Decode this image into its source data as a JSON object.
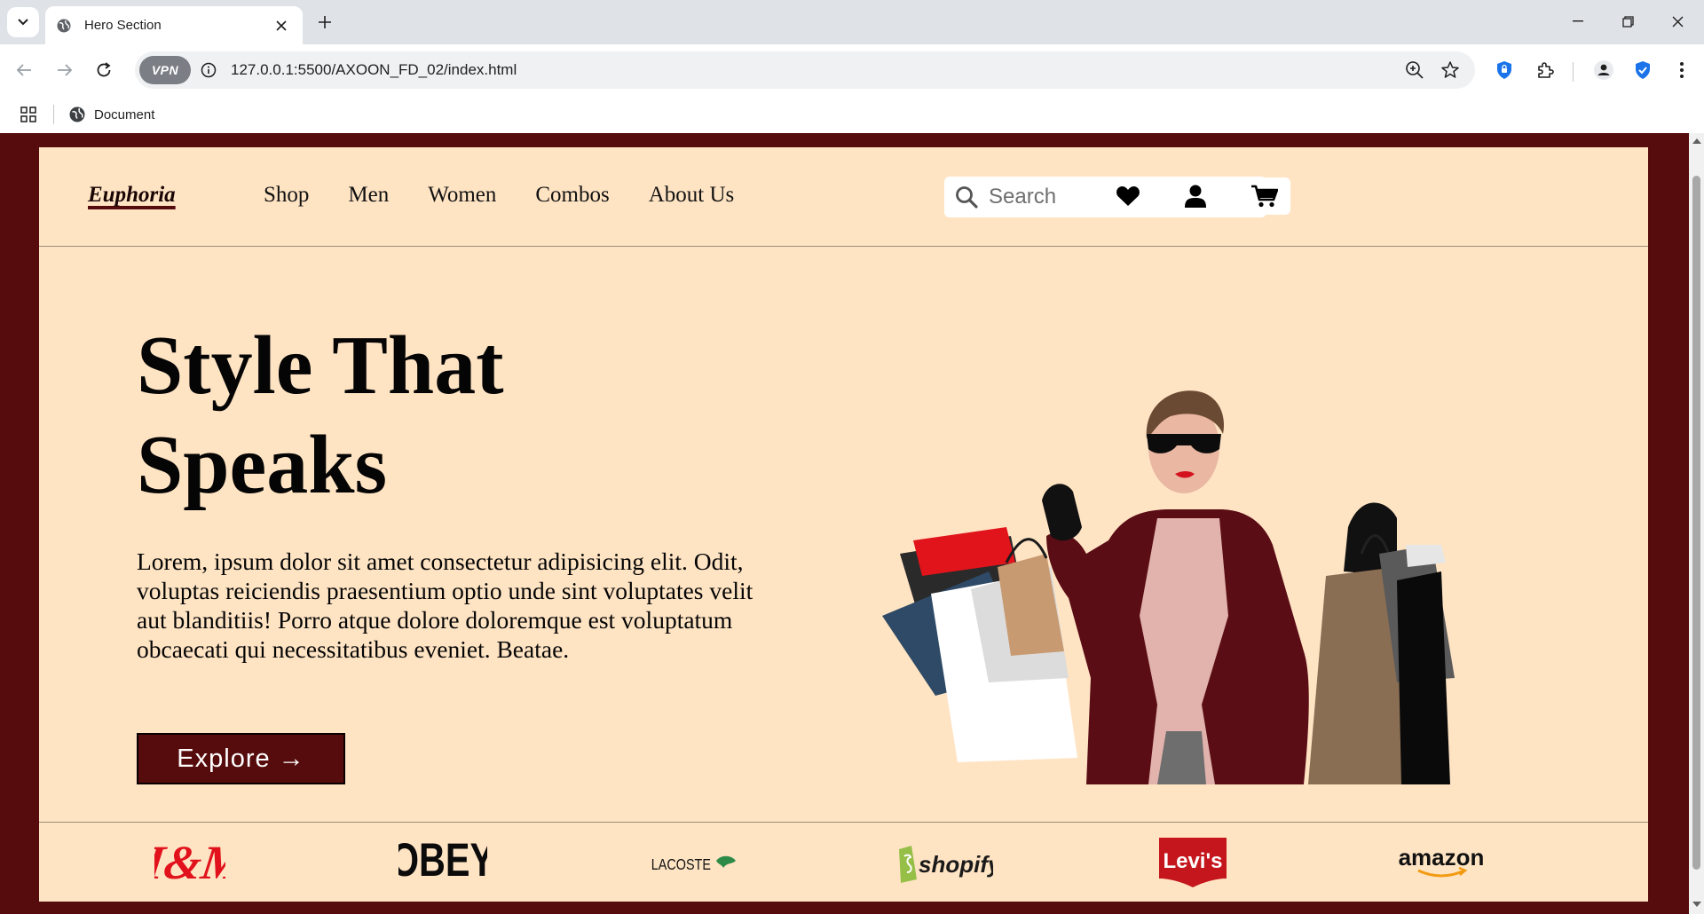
{
  "browser": {
    "tab_title": "Hero Section",
    "url": "127.0.0.1:5500/AXOON_FD_02/index.html",
    "vpn_label": "VPN",
    "bookmark_label": "Document"
  },
  "site": {
    "logo": "Euphoria",
    "nav": [
      "Shop",
      "Men",
      "Women",
      "Combos",
      "About Us"
    ],
    "search_placeholder": "Search",
    "hero": {
      "title_line1": "Style That",
      "title_line2": "Speaks",
      "body": "Lorem, ipsum dolor sit amet consectetur adipisicing elit. Odit, voluptas reiciendis praesentium optio unde sint voluptates velit aut blanditiis! Porro atque dolore doloremque est voluptatum obcaecati qui necessitatibus eveniet. Beatae.",
      "cta": "Explore →"
    },
    "brands": [
      "H&M",
      "OBEY",
      "LACOSTE",
      "shopify",
      "Levi's",
      "amazon"
    ]
  },
  "colors": {
    "maroon": "#560c0c",
    "peach": "#ffe4c4"
  }
}
